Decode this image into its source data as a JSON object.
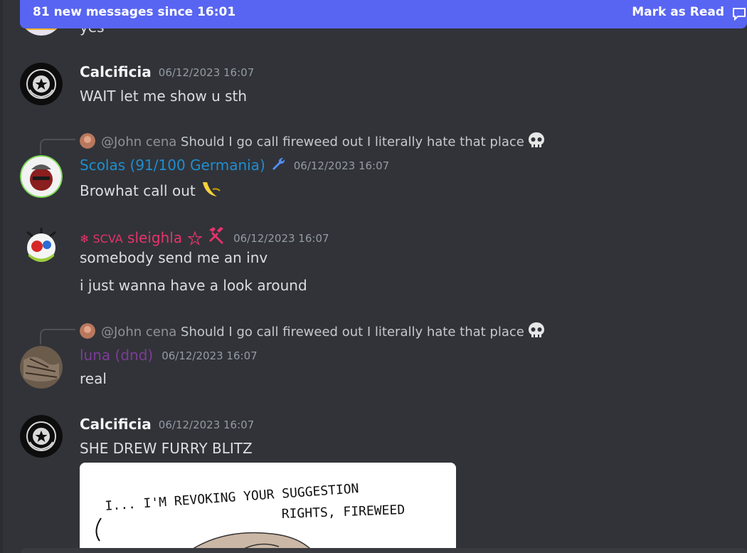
{
  "banner": {
    "text": "81 new messages since 16:01",
    "action": "Mark as Read"
  },
  "messages": [
    {
      "text": "yes"
    },
    {
      "author": "Calcificia",
      "timestamp": "06/12/2023 16:07",
      "lines": [
        "WAIT let me show u sth"
      ],
      "author_color": "#f2f3f5"
    },
    {
      "reply": {
        "author": "@John cena",
        "text": "Should I go call fireweed out I literally hate that place"
      },
      "author": "Scolas (91/100 Germania)",
      "timestamp": "06/12/2023 16:07",
      "lines": [
        "Browhat call out"
      ],
      "author_color": "#1f8ed0",
      "role_icon": "wrench-icon"
    },
    {
      "author_prefix": "❄ SCVA",
      "author": "sleighla",
      "timestamp": "06/12/2023 16:07",
      "lines": [
        "somebody send me an inv",
        "i just wanna have a look around"
      ],
      "author_color": "#e8336b",
      "role_icon": "hammer-icon"
    },
    {
      "reply": {
        "author": "@John cena",
        "text": "Should I go call fireweed out I literally hate that place"
      },
      "author": "luna (dnd)",
      "timestamp": "06/12/2023 16:07",
      "lines": [
        "real"
      ],
      "author_color": "#7d3c98"
    },
    {
      "author": "Calcificia",
      "timestamp": "06/12/2023 16:07",
      "lines": [
        "SHE DREW FURRY BLITZ"
      ],
      "author_color": "#f2f3f5",
      "attachment": {
        "line1": "I... I'M REVOKING YOUR SUGGESTION",
        "line2": "RIGHTS, FIREWEED"
      }
    }
  ],
  "colors": {
    "background": "#313338",
    "banner": "#5865f2",
    "timestamp": "#949ba4"
  }
}
